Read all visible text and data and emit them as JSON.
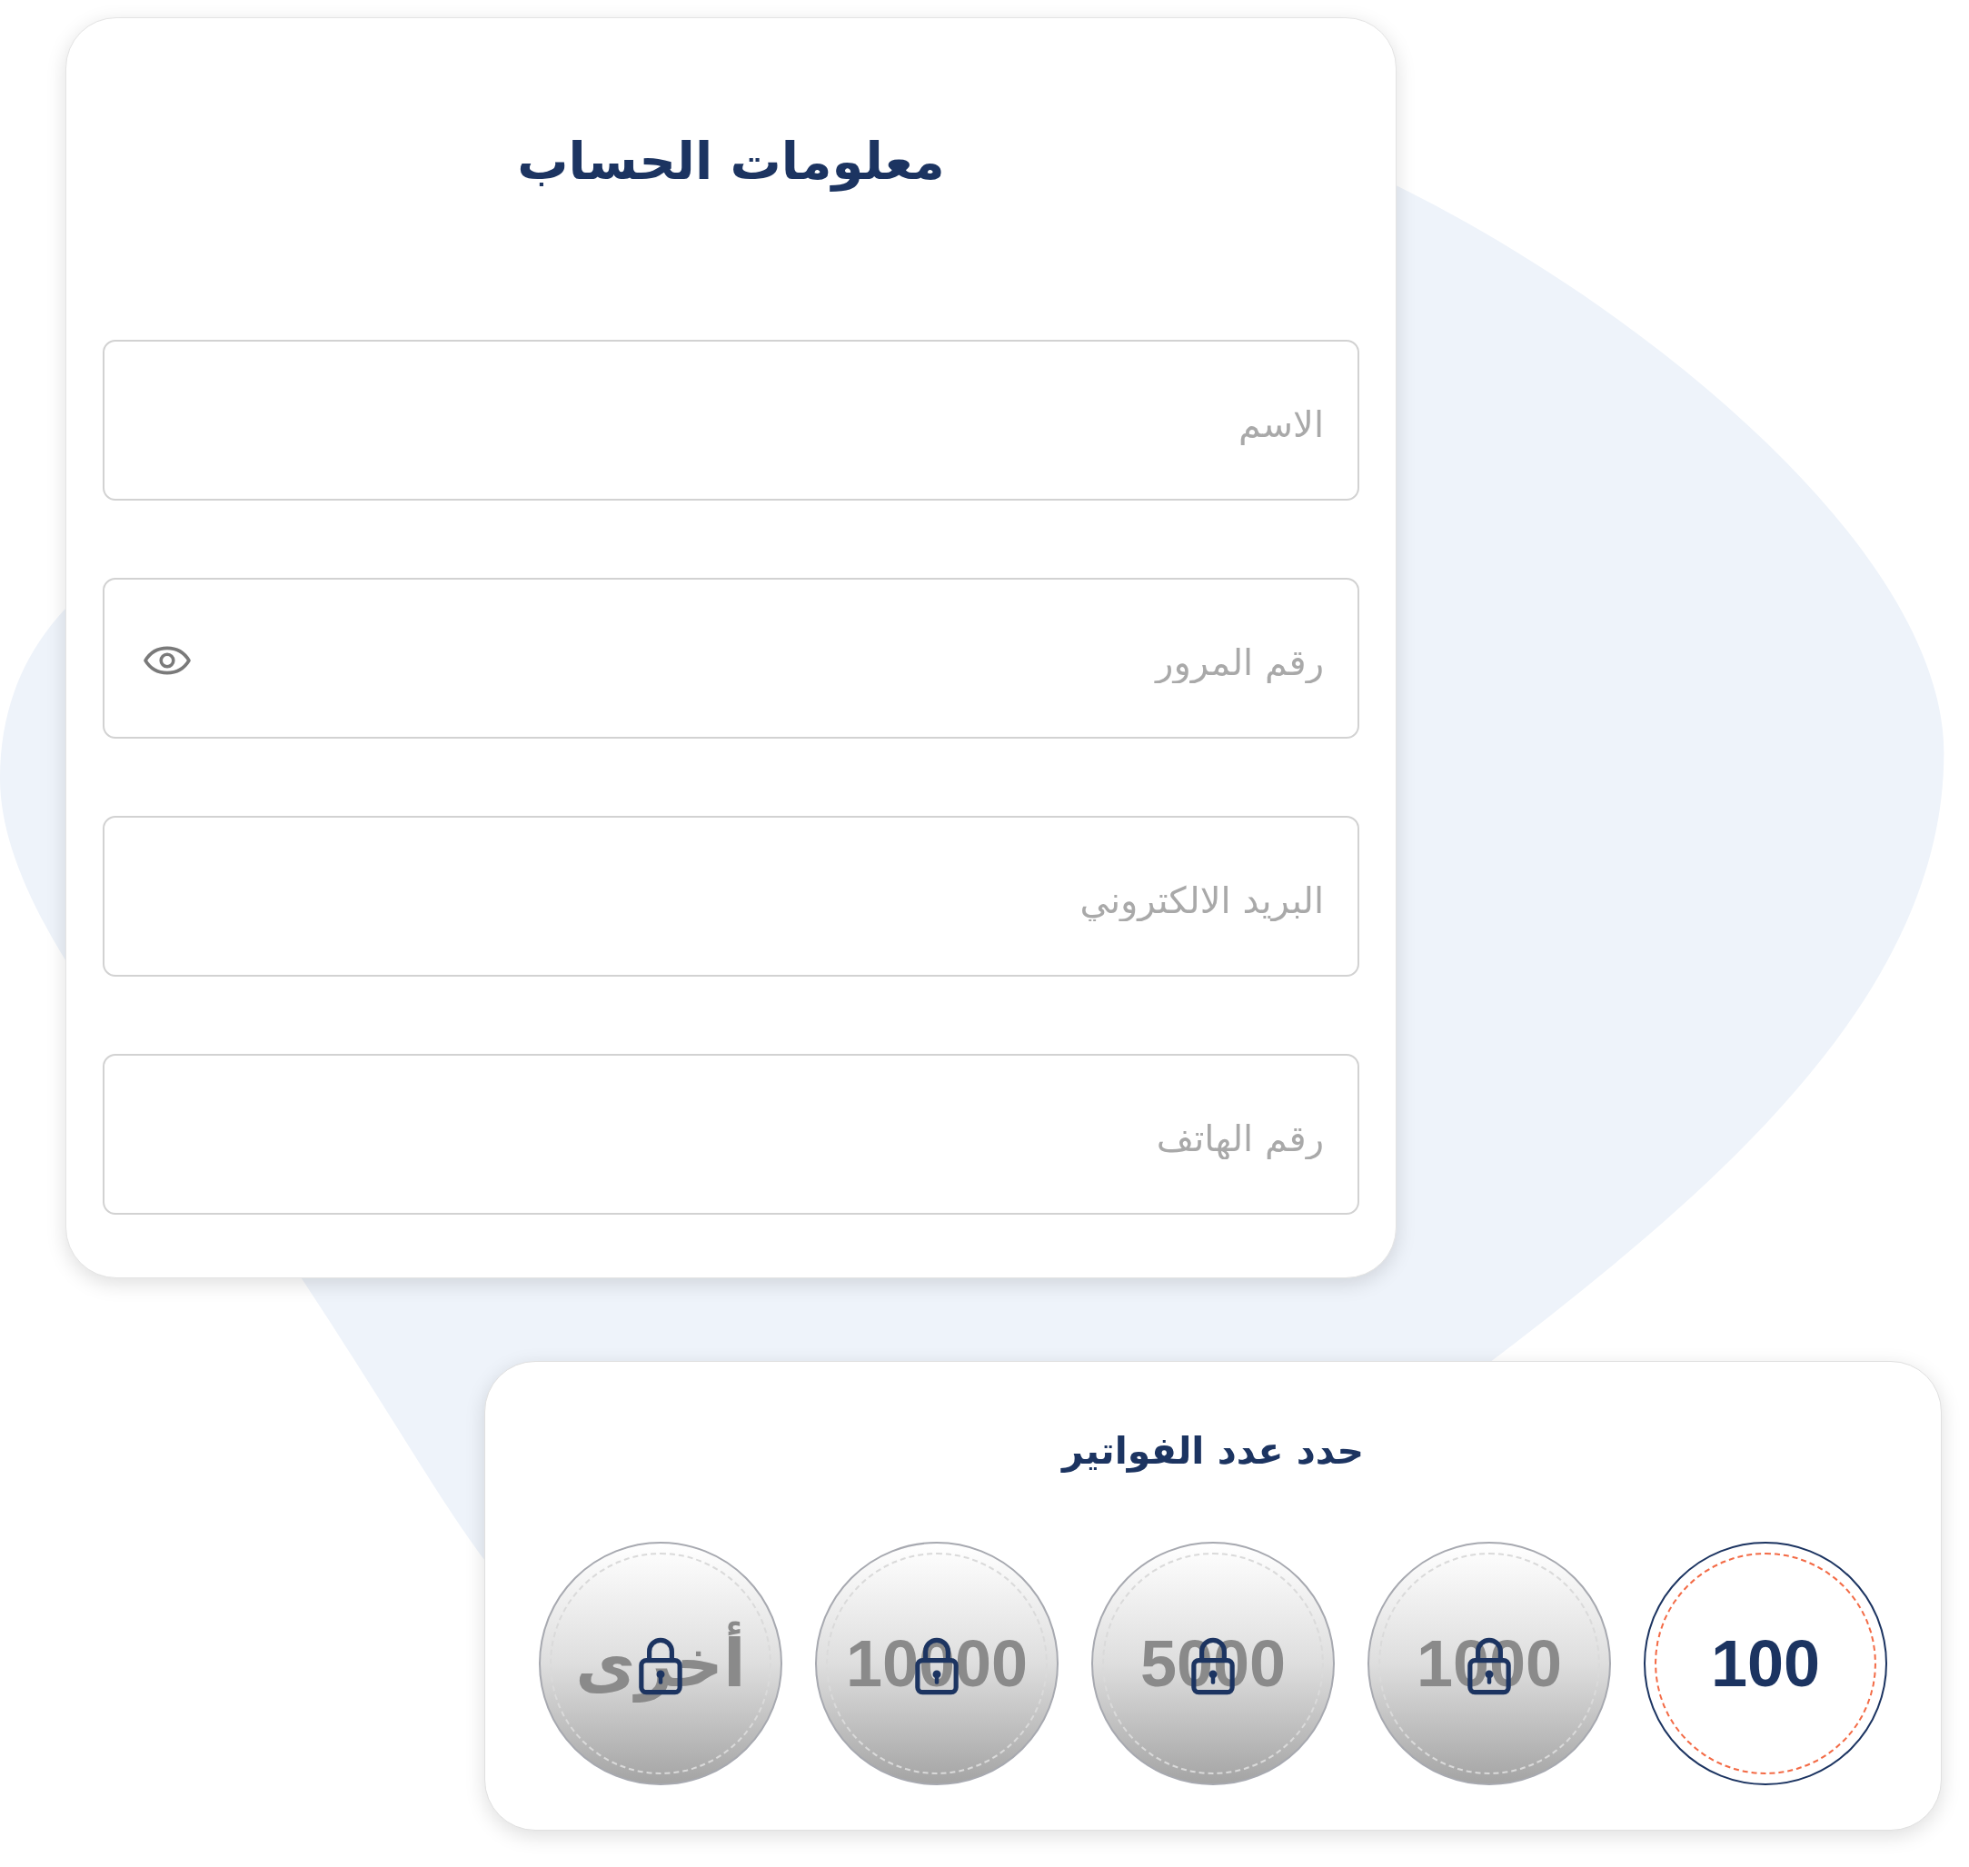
{
  "account_card": {
    "title": "معلومات الحساب",
    "fields": [
      {
        "kind": "text",
        "placeholder": "الاسم"
      },
      {
        "kind": "password",
        "placeholder": "رقم المرور"
      },
      {
        "kind": "email",
        "placeholder": "البريد الالكتروني"
      },
      {
        "kind": "tel",
        "placeholder": "رقم الهاتف"
      }
    ]
  },
  "invoice_limit_card": {
    "title": "حدد عدد الفواتير",
    "options": [
      {
        "label": "100",
        "selected": true,
        "locked": false
      },
      {
        "label": "1000",
        "selected": false,
        "locked": true
      },
      {
        "label": "5000",
        "selected": false,
        "locked": true
      },
      {
        "label": "10000",
        "selected": false,
        "locked": true
      },
      {
        "label": "أخرى",
        "selected": false,
        "locked": true
      }
    ]
  }
}
